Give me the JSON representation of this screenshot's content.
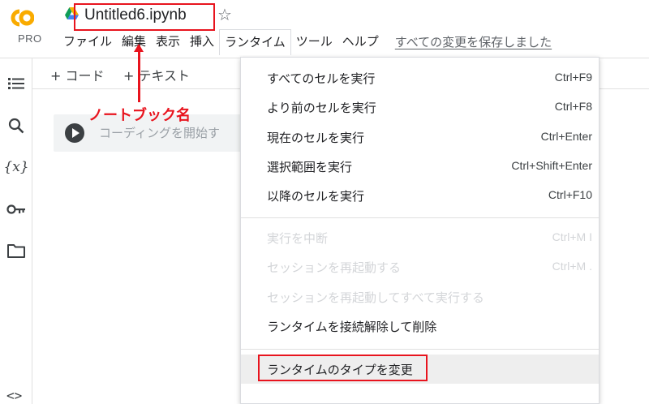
{
  "logo": {
    "text": "CO",
    "tier": "PRO"
  },
  "header": {
    "title": "Untitled6.ipynb",
    "menus": [
      "ファイル",
      "編集",
      "表示",
      "挿入",
      "ランタイム",
      "ツール",
      "ヘルプ"
    ],
    "save_status": "すべての変更を保存しました"
  },
  "toolbar": {
    "add_code": "+ コード",
    "add_text": "+ テキスト"
  },
  "cell": {
    "placeholder": "コーディングを開始す"
  },
  "annotation": {
    "label": "ノートブック名",
    "color": "#e8141e"
  },
  "rail_icons": [
    "toc-icon",
    "search-icon",
    "variables-icon",
    "key-icon",
    "folder-icon",
    "code-icon"
  ],
  "runtime_menu": {
    "items": [
      {
        "label": "すべてのセルを実行",
        "shortcut": "Ctrl+F9"
      },
      {
        "label": "より前のセルを実行",
        "shortcut": "Ctrl+F8"
      },
      {
        "label": "現在のセルを実行",
        "shortcut": "Ctrl+Enter"
      },
      {
        "label": "選択範囲を実行",
        "shortcut": "Ctrl+Shift+Enter"
      },
      {
        "label": "以降のセルを実行",
        "shortcut": "Ctrl+F10"
      },
      {
        "label": "実行を中断",
        "shortcut": "Ctrl+M I"
      },
      {
        "label": "セッションを再起動する",
        "shortcut": "Ctrl+M ."
      },
      {
        "label": "セッションを再起動してすべて実行する",
        "shortcut": ""
      },
      {
        "label": "ランタイムを接続解除して削除",
        "shortcut": ""
      },
      {
        "label": "ランタイムのタイプを変更",
        "shortcut": ""
      }
    ]
  }
}
